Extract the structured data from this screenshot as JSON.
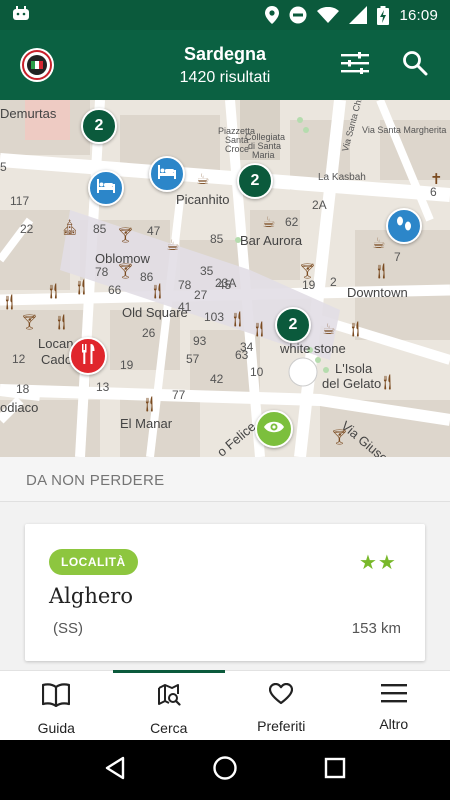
{
  "status_bar": {
    "time": "16:09",
    "icons": [
      "android-notification-icon",
      "location-icon",
      "do-not-disturb-icon",
      "wifi-icon",
      "signal-icon",
      "battery-charging-icon"
    ]
  },
  "app_bar": {
    "title": "Sardegna",
    "subtitle": "1420 risultati",
    "logo_icon": "app-logo-icon",
    "filter_icon": "filter-sliders-icon",
    "search_icon": "search-icon"
  },
  "map": {
    "clusters": [
      {
        "count": "2"
      },
      {
        "count": "2"
      },
      {
        "count": "2"
      }
    ],
    "labels": {
      "demurtas": "Demurtas",
      "picanhito": "Picanhito",
      "bar_aurora": "Bar Aurora",
      "oblomow": "Oblomow",
      "old_square": "Old Square",
      "downtown": "Downtown",
      "white_stone": "white stone",
      "isola_gelato_1": "L'Isola",
      "isola_gelato_2": "del Gelato",
      "el_manar": "El Manar",
      "locanda_1": "Locan",
      "locanda_2": "Cado",
      "zodiaco": "odiaco",
      "via_giuseppe": "Via Giuse",
      "via_felice": "o Felice",
      "piazzetta_1": "Piazzetta",
      "piazzetta_2": "Santa",
      "piazzetta_3": "Croce",
      "collegiata_1": "Collegiata",
      "collegiata_2": "di Santa",
      "collegiata_3": "Maria",
      "via_santa_chiara": "Via Santa Chiara",
      "via_s_margherita": "Via Santa Margherita",
      "la_kasbah": "La Kasbah"
    },
    "numbers": [
      "117",
      "85",
      "47",
      "85",
      "78",
      "86",
      "45",
      "35",
      "66",
      "78",
      "27",
      "23A",
      "41",
      "103",
      "26",
      "93",
      "19",
      "57",
      "77",
      "63",
      "42",
      "10",
      "34",
      "19",
      "2A",
      "62",
      "2",
      "19",
      "18",
      "7",
      "6",
      "22",
      "12",
      "13",
      "18",
      "5"
    ]
  },
  "section": {
    "title": "DA NON PERDERE"
  },
  "card": {
    "category": "LOCALITÀ",
    "stars": "★★",
    "title": "Alghero",
    "province": "(SS)",
    "distance": "153 km"
  },
  "bottom_nav": {
    "items": [
      {
        "label": "Guida",
        "icon": "book-icon"
      },
      {
        "label": "Cerca",
        "icon": "map-search-icon"
      },
      {
        "label": "Preferiti",
        "icon": "heart-icon"
      },
      {
        "label": "Altro",
        "icon": "menu-icon"
      }
    ],
    "active": "Cerca"
  },
  "system_nav": {
    "icons": [
      "back-icon",
      "home-icon",
      "recents-icon"
    ]
  },
  "colors": {
    "primary": "#0b6142",
    "primary_dark": "#0b5a3c",
    "badge": "#8dc63f",
    "stars": "#78b82a",
    "pin_blue": "#2c86c9",
    "pin_red": "#e0262c",
    "pin_green": "#7cbf3d",
    "map_bg": "#ede9e1"
  }
}
